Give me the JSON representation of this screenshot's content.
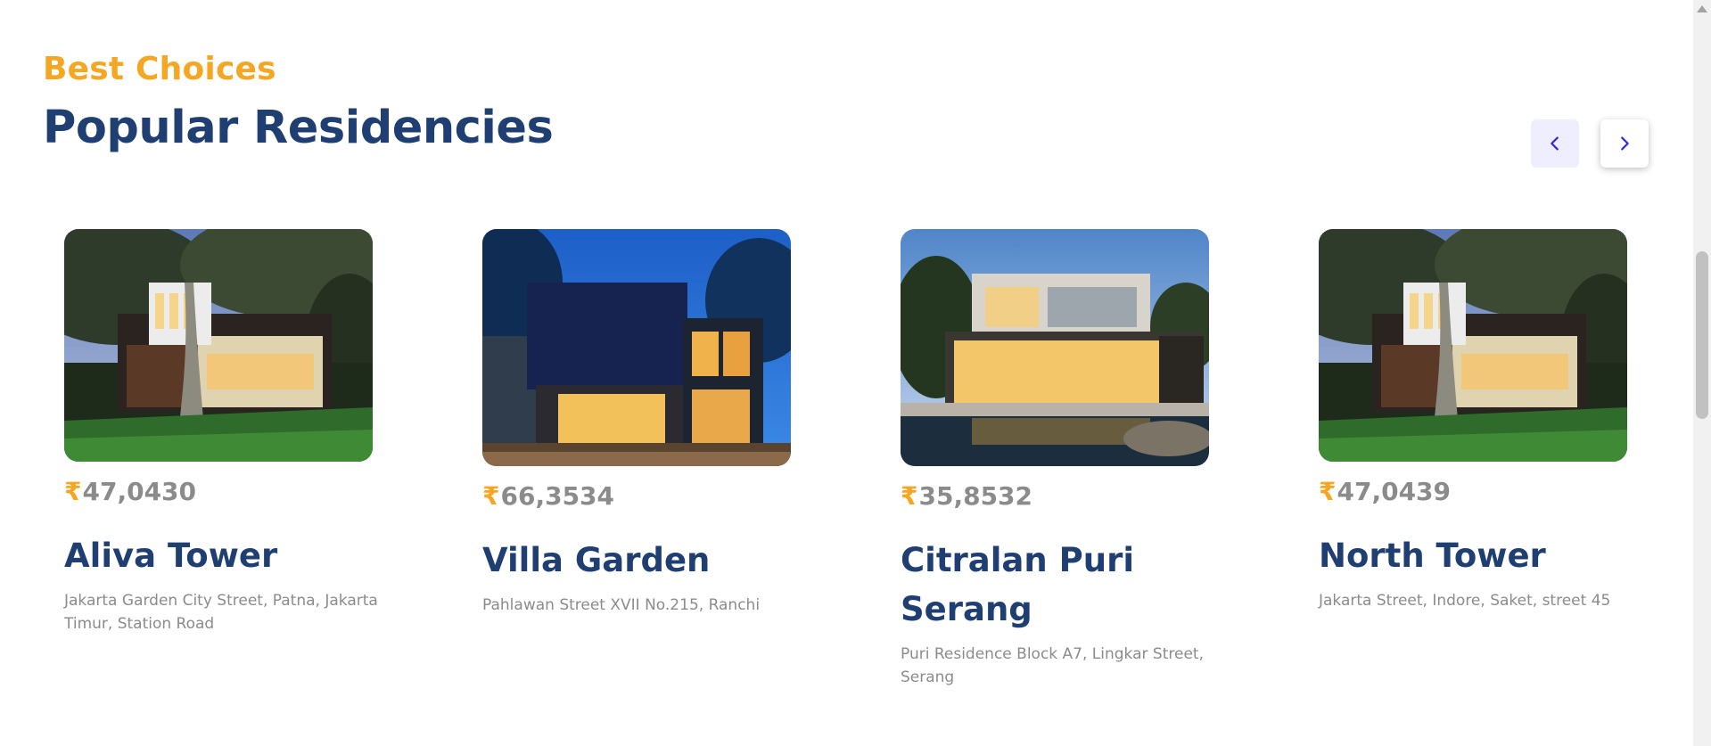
{
  "section": {
    "eyebrow": "Best Choices",
    "title": "Popular Residencies"
  },
  "nav": {
    "prev_icon": "chevron-left-icon",
    "next_icon": "chevron-right-icon"
  },
  "residencies": [
    {
      "currency": "₹",
      "price": "47,0430",
      "name": "Aliva Tower",
      "address": "Jakarta Garden City Street, Patna, Jakarta Timur, Station Road"
    },
    {
      "currency": "₹",
      "price": "66,3534",
      "name": "Villa Garden",
      "address": "Pahlawan Street XVII No.215, Ranchi"
    },
    {
      "currency": "₹",
      "price": "35,8532",
      "name": "Citralan Puri Serang",
      "address": "Puri Residence Block A7, Lingkar Street, Serang"
    },
    {
      "currency": "₹",
      "price": "47,0439",
      "name": "North Tower",
      "address": "Jakarta Street, Indore, Saket, street 45"
    }
  ],
  "colors": {
    "accent": "#f5a623",
    "heading": "#1f3e72",
    "muted": "#8c8b8b",
    "nav_prev_bg": "#eeeeff",
    "nav_arrow": "#2b2bd6"
  }
}
